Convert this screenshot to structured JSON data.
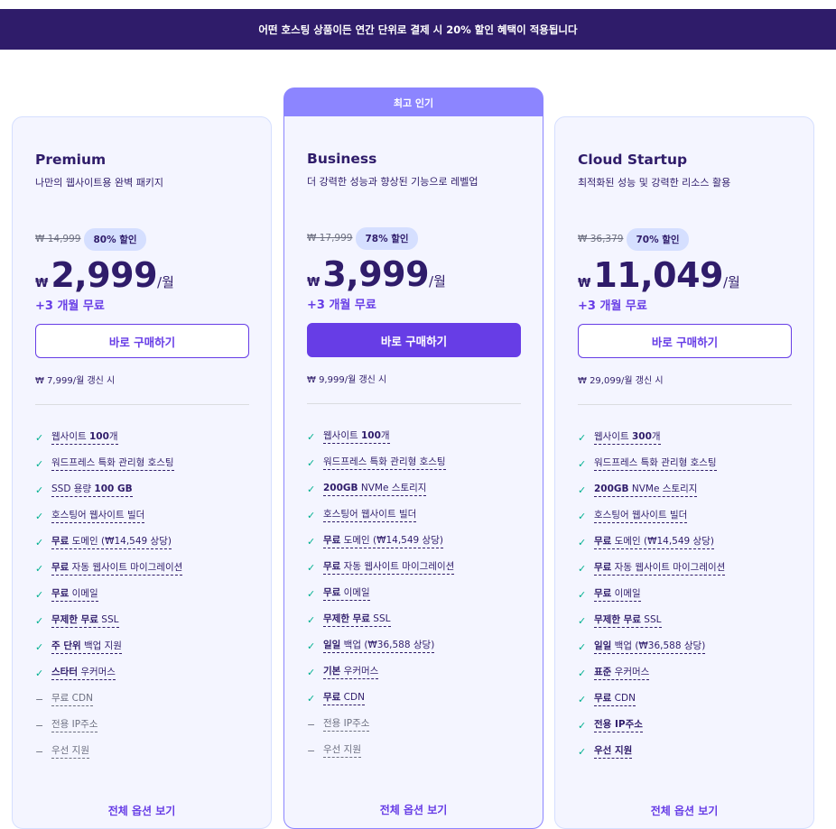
{
  "banner": "어떤 호스팅 상품이든 연간 단위로 결제 시 20% 할인 혜택이 적용됩니다",
  "popular_label": "최고 인기",
  "plans": [
    {
      "name": "Premium",
      "desc": "나만의 웹사이트용 완벽 패키지",
      "old_price": "₩ 14,999",
      "discount": "80% 할인",
      "currency": "₩",
      "price": "2,999",
      "per": "/월",
      "free": "+3 개월 무료",
      "button": "바로 구매하기",
      "renew": "₩ 7,999/월 갱신 시",
      "more": "전체 옵션 보기",
      "features": [
        {
          "a": "웹사이트 ",
          "b": "100",
          "c": "개",
          "on": true
        },
        {
          "a": "워드프레스 특화 관리형 호스팅",
          "b": "",
          "c": "",
          "on": true
        },
        {
          "a": "SSD 용량 ",
          "b": "100 GB",
          "c": "",
          "on": true
        },
        {
          "a": "호스팅어 웹사이트 빌더",
          "b": "",
          "c": "",
          "on": true
        },
        {
          "a": "",
          "b": "무료",
          "c": " 도메인 (₩14,549 상당)",
          "on": true
        },
        {
          "a": "",
          "b": "무료",
          "c": " 자동 웹사이트 마이그레이션",
          "on": true
        },
        {
          "a": "",
          "b": "무료",
          "c": " 이메일",
          "on": true
        },
        {
          "a": "",
          "b": "무제한 무료",
          "c": " SSL",
          "on": true
        },
        {
          "a": "",
          "b": "주 단위",
          "c": " 백업 지원",
          "on": true
        },
        {
          "a": "",
          "b": "스타터",
          "c": " 우커머스",
          "on": true
        },
        {
          "a": "무료 CDN",
          "b": "",
          "c": "",
          "on": false
        },
        {
          "a": "전용 IP주소",
          "b": "",
          "c": "",
          "on": false
        },
        {
          "a": "우선 지원",
          "b": "",
          "c": "",
          "on": false
        }
      ]
    },
    {
      "name": "Business",
      "desc": "더 강력한 성능과 향상된 기능으로 레벨업",
      "old_price": "₩ 17,999",
      "discount": "78% 할인",
      "currency": "₩",
      "price": "3,999",
      "per": "/월",
      "free": "+3 개월 무료",
      "button": "바로 구매하기",
      "renew": "₩ 9,999/월 갱신 시",
      "more": "전체 옵션 보기",
      "features": [
        {
          "a": "웹사이트 ",
          "b": "100",
          "c": "개",
          "on": true
        },
        {
          "a": "워드프레스 특화 관리형 호스팅",
          "b": "",
          "c": "",
          "on": true
        },
        {
          "a": "",
          "b": "200GB",
          "c": " NVMe 스토리지",
          "on": true
        },
        {
          "a": "호스팅어 웹사이트 빌더",
          "b": "",
          "c": "",
          "on": true
        },
        {
          "a": "",
          "b": "무료",
          "c": " 도메인 (₩14,549 상당)",
          "on": true
        },
        {
          "a": "",
          "b": "무료",
          "c": " 자동 웹사이트 마이그레이션",
          "on": true
        },
        {
          "a": "",
          "b": "무료",
          "c": " 이메일",
          "on": true
        },
        {
          "a": "",
          "b": "무제한 무료",
          "c": " SSL",
          "on": true
        },
        {
          "a": "",
          "b": "일일",
          "c": " 백업 (₩36,588 상당)",
          "on": true
        },
        {
          "a": "",
          "b": "기본",
          "c": " 우커머스",
          "on": true
        },
        {
          "a": "",
          "b": "무료",
          "c": " CDN",
          "on": true
        },
        {
          "a": "전용 IP주소",
          "b": "",
          "c": "",
          "on": false
        },
        {
          "a": "우선 지원",
          "b": "",
          "c": "",
          "on": false
        }
      ]
    },
    {
      "name": "Cloud Startup",
      "desc": "최적화된 성능 및 강력한 리소스 활용",
      "old_price": "₩ 36,379",
      "discount": "70% 할인",
      "currency": "₩",
      "price": "11,049",
      "per": "/월",
      "free": "+3 개월 무료",
      "button": "바로 구매하기",
      "renew": "₩ 29,099/월 갱신 시",
      "more": "전체 옵션 보기",
      "features": [
        {
          "a": "웹사이트 ",
          "b": "300",
          "c": "개",
          "on": true
        },
        {
          "a": "워드프레스 특화 관리형 호스팅",
          "b": "",
          "c": "",
          "on": true
        },
        {
          "a": "",
          "b": "200GB",
          "c": " NVMe 스토리지",
          "on": true
        },
        {
          "a": "호스팅어 웹사이트 빌더",
          "b": "",
          "c": "",
          "on": true
        },
        {
          "a": "",
          "b": "무료",
          "c": " 도메인 (₩14,549 상당)",
          "on": true
        },
        {
          "a": "",
          "b": "무료",
          "c": " 자동 웹사이트 마이그레이션",
          "on": true
        },
        {
          "a": "",
          "b": "무료",
          "c": " 이메일",
          "on": true
        },
        {
          "a": "",
          "b": "무제한 무료",
          "c": " SSL",
          "on": true
        },
        {
          "a": "",
          "b": "일일",
          "c": " 백업 (₩36,588 상당)",
          "on": true
        },
        {
          "a": "",
          "b": "표준",
          "c": " 우커머스",
          "on": true
        },
        {
          "a": "",
          "b": "무료",
          "c": " CDN",
          "on": true
        },
        {
          "a": "",
          "b": "전용 IP주소",
          "c": "",
          "on": true
        },
        {
          "a": "",
          "b": "우선 지원",
          "c": "",
          "on": true
        }
      ]
    }
  ]
}
